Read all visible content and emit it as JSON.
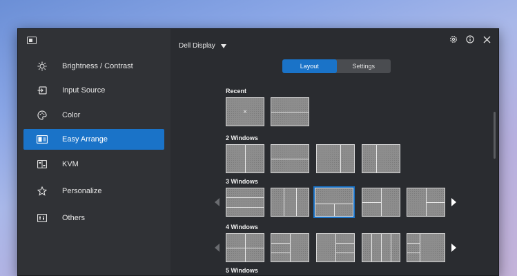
{
  "sidebar": {
    "items": [
      {
        "label": "Brightness / Contrast",
        "icon": "brightness-icon",
        "active": false
      },
      {
        "label": "Input Source",
        "icon": "input-source-icon",
        "active": false
      },
      {
        "label": "Color",
        "icon": "palette-icon",
        "active": false
      },
      {
        "label": "Easy Arrange",
        "icon": "easy-arrange-icon",
        "active": true
      },
      {
        "label": "KVM",
        "icon": "kvm-icon",
        "active": false
      },
      {
        "label": "Personalize",
        "icon": "star-icon",
        "active": false
      },
      {
        "label": "Others",
        "icon": "others-icon",
        "active": false
      }
    ]
  },
  "header": {
    "monitor": "Dell Display"
  },
  "tabs": [
    {
      "label": "Layout",
      "active": true
    },
    {
      "label": "Settings",
      "active": false
    }
  ],
  "sections": {
    "recent": "Recent",
    "two": "2 Windows",
    "three": "3 Windows",
    "four": "4 Windows",
    "five": "5 Windows"
  },
  "recent_clear_glyph": "×",
  "colors": {
    "accent": "#1a73c8",
    "window_bg": "#2b2d31",
    "sidebar_bg": "#303236"
  }
}
